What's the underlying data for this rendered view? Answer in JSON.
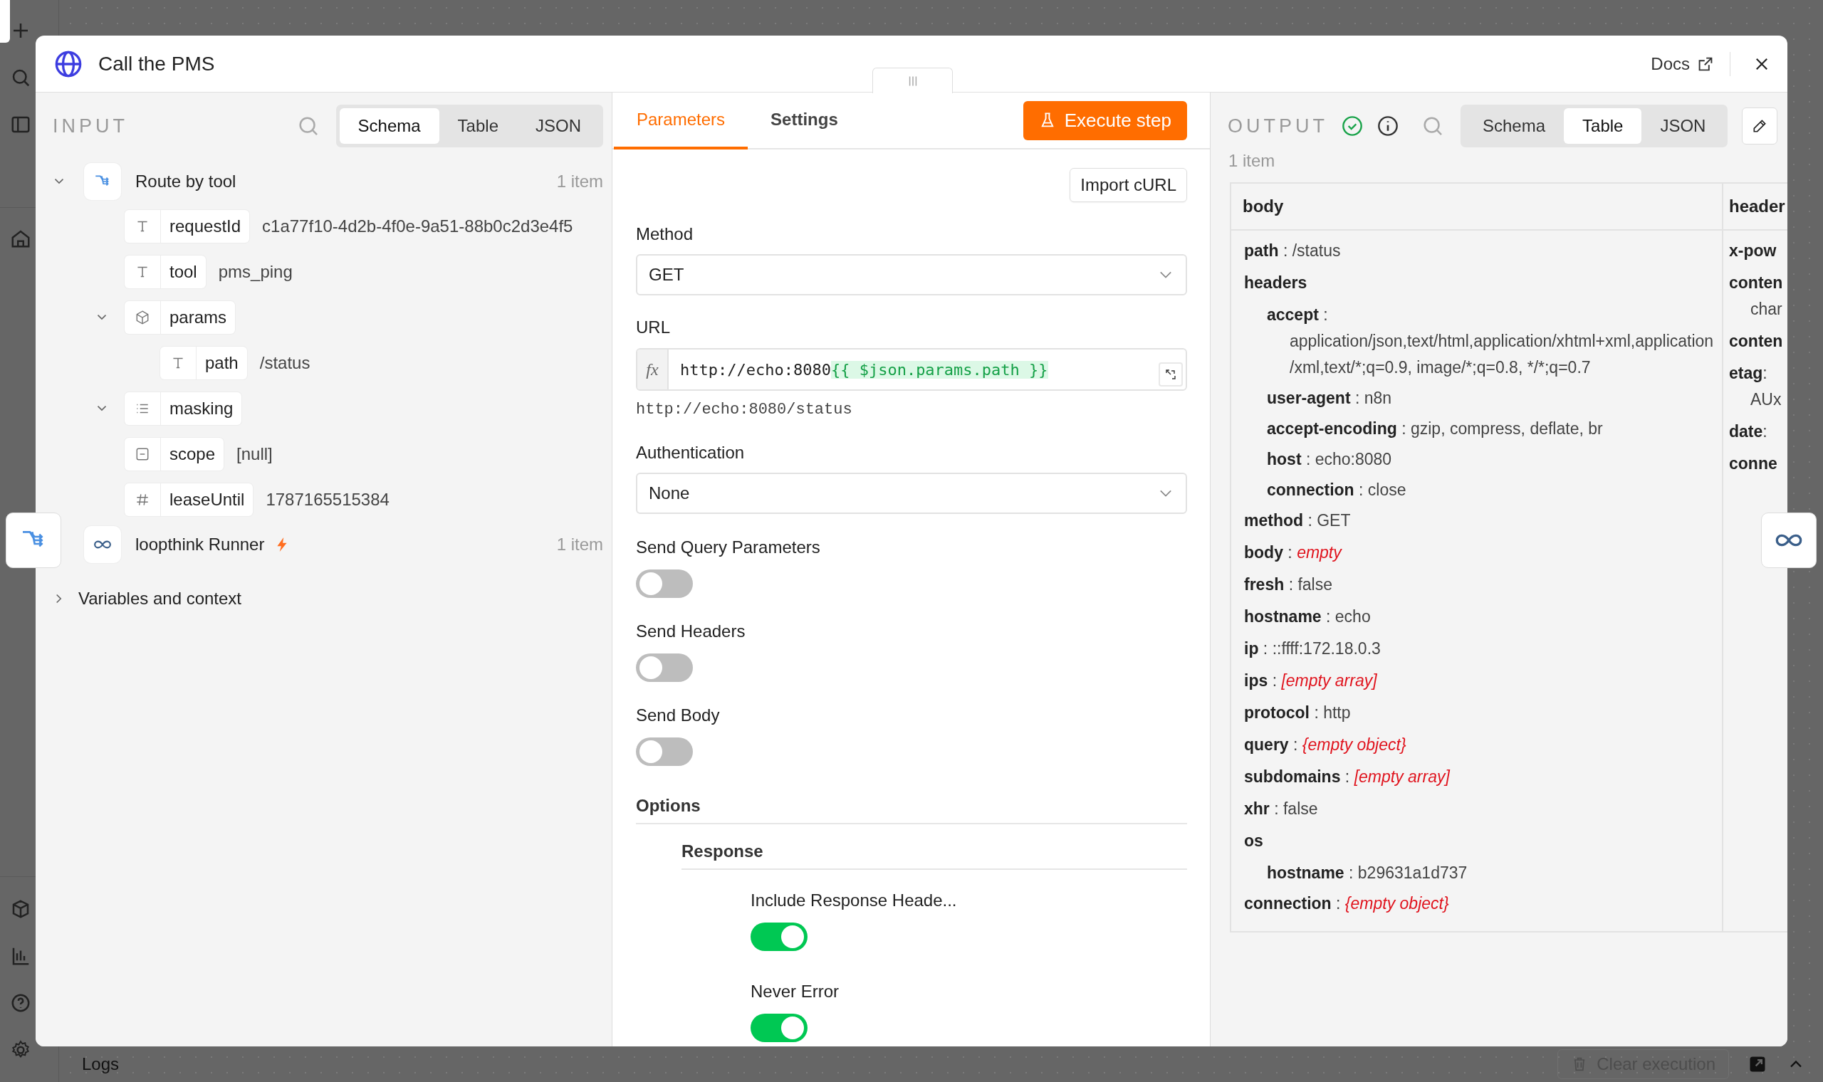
{
  "bottom_bar": {
    "logs_label": "Logs",
    "clear_button": {
      "label": "Clear execution",
      "disabled": true
    }
  },
  "modal": {
    "title": "Call the PMS",
    "docs_link": "Docs"
  },
  "input_panel": {
    "heading": "INPUT",
    "view_tabs": [
      {
        "label": "Schema",
        "selected": true
      },
      {
        "label": "Table",
        "selected": false
      },
      {
        "label": "JSON",
        "selected": false
      }
    ],
    "nodes": [
      {
        "kind": "router",
        "name": "Route by tool",
        "count": "1 item",
        "expanded": true,
        "fields": [
          {
            "kind": "string",
            "name": "requestId",
            "value": "c1a77f10-4d2b-4f0e-9a51-88b0c2d3e4f5"
          },
          {
            "kind": "string",
            "name": "tool",
            "value": "pms_ping"
          },
          {
            "kind": "object",
            "name": "params",
            "expanded": true,
            "children": [
              {
                "kind": "string",
                "name": "path",
                "value": "/status"
              }
            ]
          },
          {
            "kind": "array",
            "name": "masking",
            "expanded": true
          },
          {
            "kind": "null",
            "name": "scope",
            "value": "[null]"
          },
          {
            "kind": "number",
            "name": "leaseUntil",
            "value": "1787165515384"
          }
        ]
      },
      {
        "kind": "loop",
        "name": "loopthink Runner",
        "count": "1 item",
        "trigger": true
      }
    ],
    "variables": {
      "label": "Variables and context",
      "expanded": false
    }
  },
  "parameters_panel": {
    "tabs": [
      {
        "label": "Parameters",
        "selected": true
      },
      {
        "label": "Settings",
        "selected": false
      }
    ],
    "execute_button": "Execute step",
    "import_button": "Import cURL",
    "fields": [
      {
        "kind": "select",
        "label": "Method",
        "value": "GET"
      },
      {
        "kind": "expression",
        "label": "URL",
        "prefix": "fx",
        "value_plain": "http://echo:8080",
        "value_expression": "{{ $json.params.path }}",
        "resolved": "http://echo:8080/status"
      },
      {
        "kind": "select",
        "label": "Authentication",
        "value": "None"
      },
      {
        "kind": "toggle",
        "label": "Send Query Parameters",
        "on": false
      },
      {
        "kind": "toggle",
        "label": "Send Headers",
        "on": false
      },
      {
        "kind": "toggle",
        "label": "Send Body",
        "on": false
      },
      {
        "kind": "section",
        "label": "Options"
      },
      {
        "kind": "subsection",
        "label": "Response"
      },
      {
        "kind": "option_toggle",
        "label": "Include Response Heade...",
        "on": true
      },
      {
        "kind": "option_toggle",
        "label": "Never Error",
        "on": true
      }
    ]
  },
  "output_panel": {
    "heading": "OUTPUT",
    "success": true,
    "view_tabs": [
      {
        "label": "Schema",
        "selected": false
      },
      {
        "label": "Table",
        "selected": true
      },
      {
        "label": "JSON",
        "selected": false
      }
    ],
    "count": "1 item",
    "table": {
      "separator": ":",
      "columns": [
        "body",
        "header"
      ],
      "body_entries": [
        {
          "key": "path",
          "value": "/status"
        },
        {
          "key": "headers",
          "children": [
            {
              "key": "accept",
              "value": "application/json,text/html,application/xhtml+xml,application/xml,text/*;q=0.9, image/*;q=0.8, */*;q=0.7"
            },
            {
              "key": "user-agent",
              "value": "n8n"
            },
            {
              "key": "accept-encoding",
              "value": "gzip, compress, deflate, br"
            },
            {
              "key": "host",
              "value": "echo:8080"
            },
            {
              "key": "connection",
              "value": "close"
            }
          ]
        },
        {
          "key": "method",
          "value": "GET"
        },
        {
          "key": "body",
          "value": "empty",
          "empty": true
        },
        {
          "key": "fresh",
          "value": "false"
        },
        {
          "key": "hostname",
          "value": "echo"
        },
        {
          "key": "ip",
          "value": "::ffff:172.18.0.3"
        },
        {
          "key": "ips",
          "value": "[empty array]",
          "empty": true
        },
        {
          "key": "protocol",
          "value": "http"
        },
        {
          "key": "query",
          "value": "{empty object}",
          "empty": true
        },
        {
          "key": "subdomains",
          "value": "[empty array]",
          "empty": true
        },
        {
          "key": "xhr",
          "value": "false"
        },
        {
          "key": "os",
          "children": [
            {
              "key": "hostname",
              "value": "b29631a1d737"
            }
          ]
        },
        {
          "key": "connection",
          "value": "{empty object}",
          "empty": true
        }
      ],
      "column_2_lines": [
        {
          "kind": "key",
          "text": "x-pow"
        },
        {
          "kind": "key",
          "text": "conten"
        },
        {
          "kind": "wrap",
          "text": "char"
        },
        {
          "kind": "key",
          "text": "conten"
        },
        {
          "kind": "key",
          "text": "etag",
          "separated": true
        },
        {
          "kind": "wrap",
          "text": "AUx"
        },
        {
          "kind": "key",
          "text": "date",
          "separated": true
        },
        {
          "kind": "key",
          "text": "conne"
        }
      ]
    }
  }
}
